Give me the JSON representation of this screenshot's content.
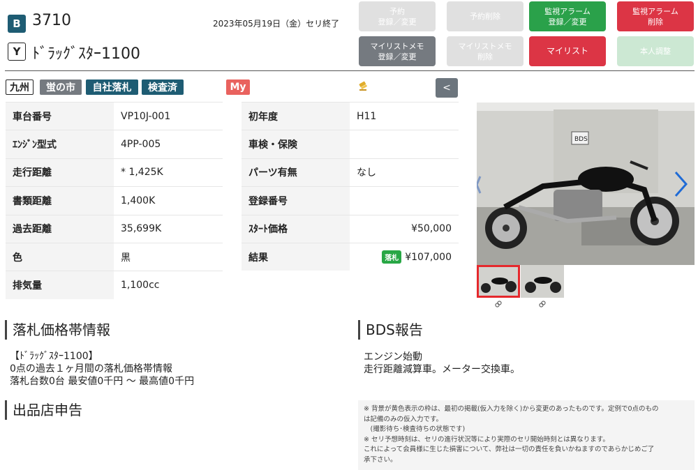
{
  "header": {
    "badge_b": "B",
    "lot_number": "3710",
    "badge_y": "Y",
    "model_name": "ﾄﾞﾗｯｸﾞｽﾀｰ1100",
    "auction_date": "2023年05月19日（金）セリ終了"
  },
  "buttons": {
    "yoyaku": [
      "予約",
      "登録／変更"
    ],
    "yoyaku_delete": "予約削除",
    "alarm_register": [
      "監視アラーム",
      "登録／変更"
    ],
    "alarm_delete": [
      "監視アラーム",
      "削除"
    ],
    "mylist_memo": [
      "マイリストメモ",
      "登録／変更"
    ],
    "mylist_memo_delete": [
      "マイリストメモ",
      "削除"
    ],
    "mylist": "マイリスト",
    "self_adjust": "本人調整"
  },
  "tags": {
    "region": "九州",
    "market": "蛍の市",
    "own_bid": "自社落札",
    "inspected": "検査済",
    "my": "My"
  },
  "back_label": "<",
  "specs_left": [
    {
      "label": "車台番号",
      "value": "VP10J-001"
    },
    {
      "label": "ｴﾝｼﾞﾝ型式",
      "value": "4PP-005"
    },
    {
      "label": "走行距離",
      "value": "* 1,425K"
    },
    {
      "label": "書類距離",
      "value": "1,400K"
    },
    {
      "label": "過去距離",
      "value": "35,699K"
    },
    {
      "label": "色",
      "value": "黒"
    },
    {
      "label": "排気量",
      "value": "1,100cc"
    }
  ],
  "specs_right": [
    {
      "label": "初年度",
      "value": "H11"
    },
    {
      "label": "車検・保険",
      "value": ""
    },
    {
      "label": "パーツ有無",
      "value": "なし"
    },
    {
      "label": "登録番号",
      "value": ""
    },
    {
      "label": "ｽﾀｰﾄ価格",
      "value": "¥50,000"
    },
    {
      "label": "結果",
      "badge": "落札",
      "value": "¥107,000"
    }
  ],
  "sections": {
    "price_band_title": "落札価格帯情報",
    "price_band_lines": [
      "【ﾄﾞﾗｯｸﾞｽﾀｰ1100】",
      "0点の過去１ヶ月間の落札価格帯情報",
      "落札台数0台 最安値0千円 ～ 最高値0千円"
    ],
    "bds_title": "BDS報告",
    "bds_lines": [
      "エンジン始動",
      "走行距離減算車。メーター交換車。"
    ],
    "shop_title": "出品店申告",
    "notes": [
      "※ 背景が黄色表示の枠は、最初の掲載(仮入力を除く)から変更のあったものです。定例で0点のもの",
      "は記備のみの仮入力です。",
      "　(撮影待ち･検査待ちの状態です)",
      "※ セリ予想時刻は、セリの進行状況等により実際のセリ開始時刻とは異なります。",
      "これによって会員様に生じた損害について、弊社は一切の責任を負いかねますのであらかじめご了",
      "承下さい。"
    ]
  },
  "photo": {
    "sign_text": "BDS"
  }
}
